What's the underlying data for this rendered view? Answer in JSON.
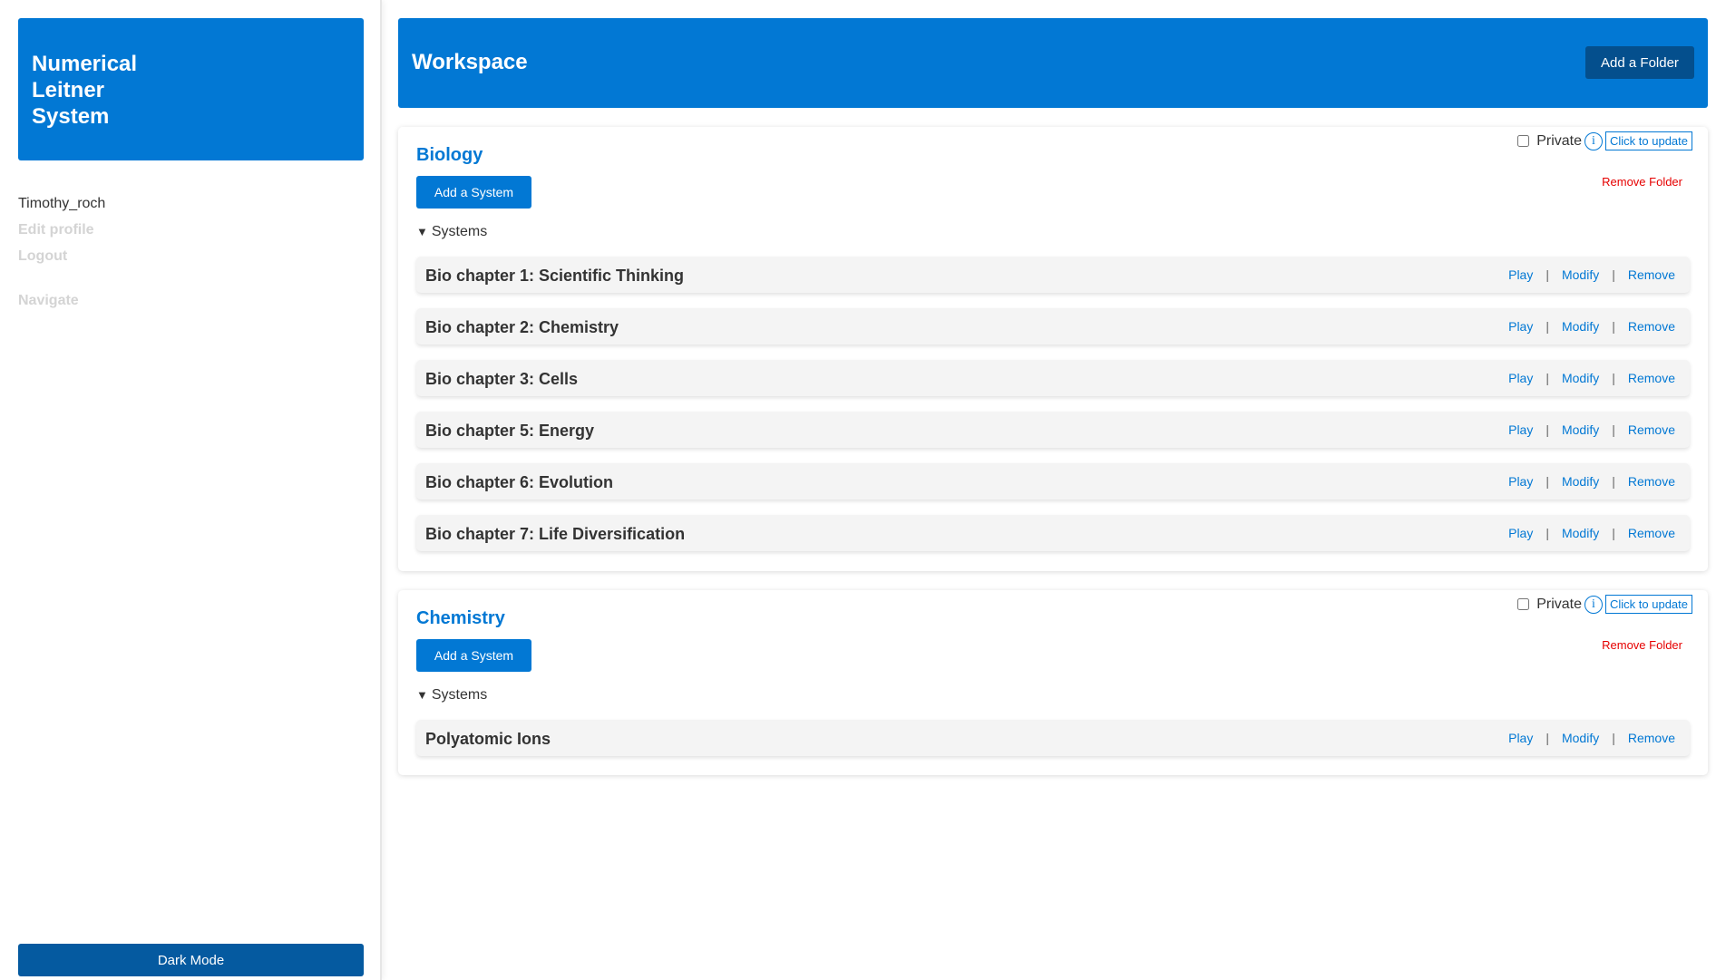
{
  "sidebar": {
    "brand_lines": [
      "Numerical",
      "Leitner",
      "System"
    ],
    "username": "Timothy_roch",
    "edit_profile": "Edit profile",
    "logout": "Logout",
    "navigate": "Navigate",
    "dark_mode": "Dark Mode"
  },
  "header": {
    "title": "Workspace",
    "add_folder": "Add a Folder"
  },
  "folders": [
    {
      "title": "Biology",
      "add_system": "Add a System",
      "private_label": "Private",
      "update_label": "Click to update",
      "remove_label": "Remove Folder",
      "systems_label": "Systems",
      "systems": [
        "Bio chapter 1: Scientific Thinking",
        "Bio chapter 2: Chemistry",
        "Bio chapter 3: Cells",
        "Bio chapter 5: Energy",
        "Bio chapter 6: Evolution",
        "Bio chapter 7: Life Diversification"
      ]
    },
    {
      "title": "Chemistry",
      "add_system": "Add a System",
      "private_label": "Private",
      "update_label": "Click to update",
      "remove_label": "Remove Folder",
      "systems_label": "Systems",
      "systems": [
        "Polyatomic Ions"
      ]
    }
  ],
  "actions": {
    "play": "Play",
    "modify": "Modify",
    "remove": "Remove",
    "separator": "|"
  },
  "colors": {
    "primary": "#0278d4",
    "dark_button": "#055aa0",
    "danger": "#e60000"
  },
  "icons": {
    "info": "info-icon",
    "collapse": "triangle-down-icon"
  }
}
